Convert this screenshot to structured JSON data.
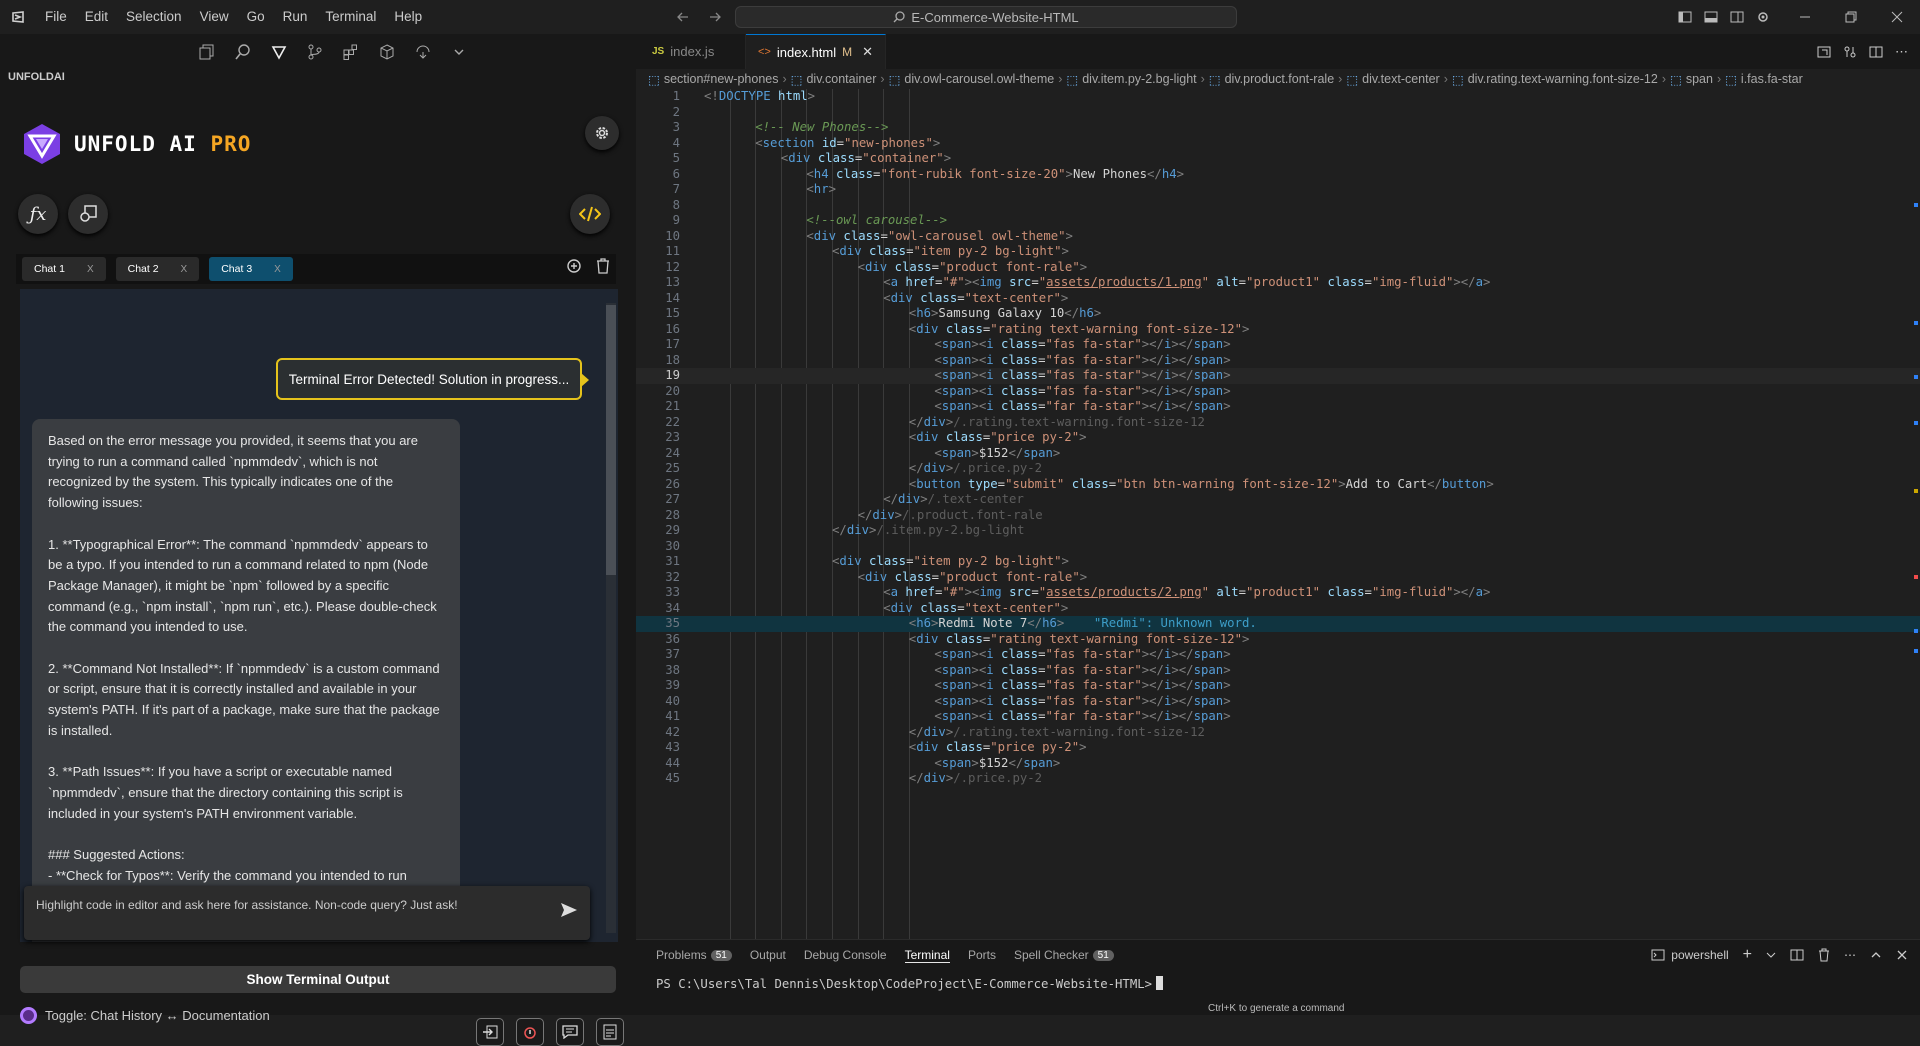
{
  "menubar": {
    "items": [
      "File",
      "Edit",
      "Selection",
      "View",
      "Go",
      "Run",
      "Terminal",
      "Help"
    ]
  },
  "search": {
    "text": "E-Commerce-Website-HTML"
  },
  "left_panel": {
    "heading": "UNFOLDAI",
    "brand": {
      "name": "UNFOLD AI",
      "pro": "PRO"
    },
    "chat_tabs": [
      {
        "label": "Chat 1",
        "close": "X"
      },
      {
        "label": "Chat 2",
        "close": "X"
      },
      {
        "label": "Chat 3",
        "close": "X"
      }
    ],
    "notice": "Terminal Error Detected! Solution in progress...",
    "message": "Based on the error message you provided, it seems that you are trying to run a command called `npmmdedv`, which is not recognized by the system. This typically indicates one of the following issues:\n\n1. **Typographical Error**: The command `npmmdedv` appears to be a typo. If you intended to run a command related to npm (Node Package Manager), it might be `npm` followed by a specific command (e.g., `npm install`, `npm run`, etc.). Please double-check the command you intended to use.\n\n2. **Command Not Installed**: If `npmmdedv` is a custom command or script, ensure that it is correctly installed and available in your system's PATH. If it's part of a package, make sure that the package is installed.\n\n3. **Path Issues**: If you have a script or executable named `npmmdedv`, ensure that the directory containing this script is included in your system's PATH environment variable.\n\n### Suggested Actions:\n- **Check for Typos**: Verify the command you intended to run\nvalid npm command, such as:",
    "input_placeholder": "Highlight code in editor and ask here for assistance. Non-code query? Just ask!",
    "show_terminal_label": "Show Terminal Output",
    "toggle_label": "Toggle: Chat History ↔ Documentation"
  },
  "editor": {
    "tabs": [
      {
        "label": "index.js",
        "icon": "JS"
      },
      {
        "label": "index.html",
        "modified": "M",
        "close": "✕"
      }
    ],
    "breadcrumbs": [
      "section#new-phones",
      "div.container",
      "div.owl-carousel.owl-theme",
      "div.item.py-2.bg-light",
      "div.product.font-rale",
      "div.text-center",
      "div.rating.text-warning.font-size-12",
      "span",
      "i.fas.fa-star"
    ],
    "current_line": 19,
    "lines": [
      {
        "n": "1",
        "i": 0,
        "html": "<span class='p'>&lt;!</span><span class='t'>DOCTYPE</span> <span class='a'>html</span><span class='p'>&gt;</span>"
      },
      {
        "n": "2",
        "i": 0,
        "html": ""
      },
      {
        "n": "3",
        "i": 2,
        "html": "<span class='c'>&lt;!-- New Phones--&gt;</span>"
      },
      {
        "n": "4",
        "i": 2,
        "html": "<span class='p'>&lt;</span><span class='t'>section</span> <span class='a'>id</span><span class='x'>=</span><span class='s'>\"new-phones\"</span><span class='p'>&gt;</span>"
      },
      {
        "n": "5",
        "i": 3,
        "html": "<span class='p'>&lt;</span><span class='t'>div</span> <span class='a'>class</span><span class='x'>=</span><span class='s'>\"container\"</span><span class='p'>&gt;</span>"
      },
      {
        "n": "6",
        "i": 4,
        "html": "<span class='p'>&lt;</span><span class='t'>h4</span> <span class='a'>class</span><span class='x'>=</span><span class='s'>\"font-rubik font-size-20\"</span><span class='p'>&gt;</span><span class='x'>New Phones</span><span class='p'>&lt;/</span><span class='t'>h4</span><span class='p'>&gt;</span>"
      },
      {
        "n": "7",
        "i": 4,
        "html": "<span class='p'>&lt;</span><span class='t'>hr</span><span class='p'>&gt;</span>"
      },
      {
        "n": "8",
        "i": 0,
        "html": ""
      },
      {
        "n": "9",
        "i": 4,
        "html": "<span class='c'>&lt;!--owl carousel--&gt;</span>"
      },
      {
        "n": "10",
        "i": 4,
        "html": "<span class='p'>&lt;</span><span class='t'>div</span> <span class='a'>class</span><span class='x'>=</span><span class='s'>\"owl-carousel owl-theme\"</span><span class='p'>&gt;</span>"
      },
      {
        "n": "11",
        "i": 5,
        "html": "<span class='p'>&lt;</span><span class='t'>div</span> <span class='a'>class</span><span class='x'>=</span><span class='s'>\"item py-2 bg-light\"</span><span class='p'>&gt;</span>"
      },
      {
        "n": "12",
        "i": 6,
        "html": "<span class='p'>&lt;</span><span class='t'>div</span> <span class='a'>class</span><span class='x'>=</span><span class='s'>\"product font-rale\"</span><span class='p'>&gt;</span>"
      },
      {
        "n": "13",
        "i": 7,
        "html": "<span class='p'>&lt;</span><span class='t'>a</span> <span class='a'>href</span><span class='x'>=</span><span class='s'>\"#\"</span><span class='p'>&gt;&lt;</span><span class='t'>img</span> <span class='a'>src</span><span class='x'>=</span><span class='s'>\"<u>assets/products/1.png</u>\"</span> <span class='a'>alt</span><span class='x'>=</span><span class='s'>\"product1\"</span> <span class='a'>class</span><span class='x'>=</span><span class='s'>\"img-fluid\"</span><span class='p'>&gt;&lt;/</span><span class='t'>a</span><span class='p'>&gt;</span>"
      },
      {
        "n": "14",
        "i": 7,
        "html": "<span class='p'>&lt;</span><span class='t'>div</span> <span class='a'>class</span><span class='x'>=</span><span class='s'>\"text-center\"</span><span class='p'>&gt;</span>"
      },
      {
        "n": "15",
        "i": 8,
        "html": "<span class='p'>&lt;</span><span class='t'>h6</span><span class='p'>&gt;</span><span class='x'>Samsung Galaxy 10</span><span class='p'>&lt;/</span><span class='t'>h6</span><span class='p'>&gt;</span>"
      },
      {
        "n": "16",
        "i": 8,
        "html": "<span class='p'>&lt;</span><span class='t'>div</span> <span class='a'>class</span><span class='x'>=</span><span class='s'>\"rating text-warning font-size-12\"</span><span class='p'>&gt;</span>"
      },
      {
        "n": "17",
        "i": 9,
        "html": "<span class='p'>&lt;</span><span class='t'>span</span><span class='p'>&gt;&lt;</span><span class='t'>i</span> <span class='a'>class</span><span class='x'>=</span><span class='s'>\"fas fa-star\"</span><span class='p'>&gt;&lt;/</span><span class='t'>i</span><span class='p'>&gt;&lt;/</span><span class='t'>span</span><span class='p'>&gt;</span>"
      },
      {
        "n": "18",
        "i": 9,
        "html": "<span class='p'>&lt;</span><span class='t'>span</span><span class='p'>&gt;&lt;</span><span class='t'>i</span> <span class='a'>class</span><span class='x'>=</span><span class='s'>\"fas fa-star\"</span><span class='p'>&gt;&lt;/</span><span class='t'>i</span><span class='p'>&gt;&lt;/</span><span class='t'>span</span><span class='p'>&gt;</span>"
      },
      {
        "n": "19",
        "i": 9,
        "html": "<span class='p'>&lt;</span><span class='t'>span</span><span class='p'>&gt;&lt;</span><span class='t'>i</span> <span class='a'>class</span><span class='x'>=</span><span class='s'>\"fas fa-star\"</span><span class='p'>&gt;&lt;/</span><span class='t'>i</span><span class='p'>&gt;&lt;/</span><span class='t'>span</span><span class='p'>&gt;</span>"
      },
      {
        "n": "20",
        "i": 9,
        "html": "<span class='p'>&lt;</span><span class='t'>span</span><span class='p'>&gt;&lt;</span><span class='t'>i</span> <span class='a'>class</span><span class='x'>=</span><span class='s'>\"fas fa-star\"</span><span class='p'>&gt;&lt;/</span><span class='t'>i</span><span class='p'>&gt;&lt;/</span><span class='t'>span</span><span class='p'>&gt;</span>"
      },
      {
        "n": "21",
        "i": 9,
        "html": "<span class='p'>&lt;</span><span class='t'>span</span><span class='p'>&gt;&lt;</span><span class='t'>i</span> <span class='a'>class</span><span class='x'>=</span><span class='s'>\"far fa-star\"</span><span class='p'>&gt;&lt;/</span><span class='t'>i</span><span class='p'>&gt;&lt;/</span><span class='t'>span</span><span class='p'>&gt;</span>"
      },
      {
        "n": "22",
        "i": 8,
        "html": "<span class='p'>&lt;/</span><span class='t'>div</span><span class='p'>&gt;</span><span class='cm'>/.rating.text-warning.font-size-12</span>"
      },
      {
        "n": "23",
        "i": 8,
        "html": "<span class='p'>&lt;</span><span class='t'>div</span> <span class='a'>class</span><span class='x'>=</span><span class='s'>\"price py-2\"</span><span class='p'>&gt;</span>"
      },
      {
        "n": "24",
        "i": 9,
        "html": "<span class='p'>&lt;</span><span class='t'>span</span><span class='p'>&gt;</span><span class='x'>$152</span><span class='p'>&lt;/</span><span class='t'>span</span><span class='p'>&gt;</span>"
      },
      {
        "n": "25",
        "i": 8,
        "html": "<span class='p'>&lt;/</span><span class='t'>div</span><span class='p'>&gt;</span><span class='cm'>/.price.py-2</span>"
      },
      {
        "n": "26",
        "i": 8,
        "html": "<span class='p'>&lt;</span><span class='t'>button</span> <span class='a'>type</span><span class='x'>=</span><span class='s'>\"submit\"</span> <span class='a'>class</span><span class='x'>=</span><span class='s'>\"btn btn-warning font-size-12\"</span><span class='p'>&gt;</span><span class='x'>Add to Cart</span><span class='p'>&lt;/</span><span class='t'>button</span><span class='p'>&gt;</span>"
      },
      {
        "n": "27",
        "i": 7,
        "html": "<span class='p'>&lt;/</span><span class='t'>div</span><span class='p'>&gt;</span><span class='cm'>/.text-center</span>"
      },
      {
        "n": "28",
        "i": 6,
        "html": "<span class='p'>&lt;/</span><span class='t'>div</span><span class='p'>&gt;</span><span class='cm'>/.product.font-rale</span>"
      },
      {
        "n": "29",
        "i": 5,
        "html": "<span class='p'>&lt;/</span><span class='t'>div</span><span class='p'>&gt;</span><span class='cm'>/.item.py-2.bg-light</span>"
      },
      {
        "n": "30",
        "i": 0,
        "html": ""
      },
      {
        "n": "31",
        "i": 5,
        "html": "<span class='p'>&lt;</span><span class='t'>div</span> <span class='a'>class</span><span class='x'>=</span><span class='s'>\"item py-2 bg-light\"</span><span class='p'>&gt;</span>"
      },
      {
        "n": "32",
        "i": 6,
        "html": "<span class='p'>&lt;</span><span class='t'>div</span> <span class='a'>class</span><span class='x'>=</span><span class='s'>\"product font-rale\"</span><span class='p'>&gt;</span>"
      },
      {
        "n": "33",
        "i": 7,
        "html": "<span class='p'>&lt;</span><span class='t'>a</span> <span class='a'>href</span><span class='x'>=</span><span class='s'>\"#\"</span><span class='p'>&gt;&lt;</span><span class='t'>img</span> <span class='a'>src</span><span class='x'>=</span><span class='s'>\"<u>assets/products/2.png</u>\"</span> <span class='a'>alt</span><span class='x'>=</span><span class='s'>\"product1\"</span> <span class='a'>class</span><span class='x'>=</span><span class='s'>\"img-fluid\"</span><span class='p'>&gt;&lt;/</span><span class='t'>a</span><span class='p'>&gt;</span>"
      },
      {
        "n": "34",
        "i": 7,
        "html": "<span class='p'>&lt;</span><span class='t'>div</span> <span class='a'>class</span><span class='x'>=</span><span class='s'>\"text-center\"</span><span class='p'>&gt;</span>"
      },
      {
        "n": "35",
        "i": 8,
        "html": "<span class='p'>&lt;</span><span class='t'>h6</span><span class='p'>&gt;</span><span class='x'>Redmi Note 7</span><span class='p'>&lt;/</span><span class='t'>h6</span><span class='p'>&gt;</span>    <span class='warn'>\"Redmi\": Unknown word.</span>"
      },
      {
        "n": "36",
        "i": 8,
        "html": "<span class='p'>&lt;</span><span class='t'>div</span> <span class='a'>class</span><span class='x'>=</span><span class='s'>\"rating text-warning font-size-12\"</span><span class='p'>&gt;</span>"
      },
      {
        "n": "37",
        "i": 9,
        "html": "<span class='p'>&lt;</span><span class='t'>span</span><span class='p'>&gt;&lt;</span><span class='t'>i</span> <span class='a'>class</span><span class='x'>=</span><span class='s'>\"fas fa-star\"</span><span class='p'>&gt;&lt;/</span><span class='t'>i</span><span class='p'>&gt;&lt;/</span><span class='t'>span</span><span class='p'>&gt;</span>"
      },
      {
        "n": "38",
        "i": 9,
        "html": "<span class='p'>&lt;</span><span class='t'>span</span><span class='p'>&gt;&lt;</span><span class='t'>i</span> <span class='a'>class</span><span class='x'>=</span><span class='s'>\"fas fa-star\"</span><span class='p'>&gt;&lt;/</span><span class='t'>i</span><span class='p'>&gt;&lt;/</span><span class='t'>span</span><span class='p'>&gt;</span>"
      },
      {
        "n": "39",
        "i": 9,
        "html": "<span class='p'>&lt;</span><span class='t'>span</span><span class='p'>&gt;&lt;</span><span class='t'>i</span> <span class='a'>class</span><span class='x'>=</span><span class='s'>\"fas fa-star\"</span><span class='p'>&gt;&lt;/</span><span class='t'>i</span><span class='p'>&gt;&lt;/</span><span class='t'>span</span><span class='p'>&gt;</span>"
      },
      {
        "n": "40",
        "i": 9,
        "html": "<span class='p'>&lt;</span><span class='t'>span</span><span class='p'>&gt;&lt;</span><span class='t'>i</span> <span class='a'>class</span><span class='x'>=</span><span class='s'>\"fas fa-star\"</span><span class='p'>&gt;&lt;/</span><span class='t'>i</span><span class='p'>&gt;&lt;/</span><span class='t'>span</span><span class='p'>&gt;</span>"
      },
      {
        "n": "41",
        "i": 9,
        "html": "<span class='p'>&lt;</span><span class='t'>span</span><span class='p'>&gt;&lt;</span><span class='t'>i</span> <span class='a'>class</span><span class='x'>=</span><span class='s'>\"far fa-star\"</span><span class='p'>&gt;&lt;/</span><span class='t'>i</span><span class='p'>&gt;&lt;/</span><span class='t'>span</span><span class='p'>&gt;</span>"
      },
      {
        "n": "42",
        "i": 8,
        "html": "<span class='p'>&lt;/</span><span class='t'>div</span><span class='p'>&gt;</span><span class='cm'>/.rating.text-warning.font-size-12</span>"
      },
      {
        "n": "43",
        "i": 8,
        "html": "<span class='p'>&lt;</span><span class='t'>div</span> <span class='a'>class</span><span class='x'>=</span><span class='s'>\"price py-2\"</span><span class='p'>&gt;</span>"
      },
      {
        "n": "44",
        "i": 9,
        "html": "<span class='p'>&lt;</span><span class='t'>span</span><span class='p'>&gt;</span><span class='x'>$152</span><span class='p'>&lt;/</span><span class='t'>span</span><span class='p'>&gt;</span>"
      },
      {
        "n": "45",
        "i": 8,
        "html": "<span class='p'>&lt;/</span><span class='t'>div</span><span class='p'>&gt;</span><span class='cm'>/.price.py-2</span>"
      }
    ]
  },
  "panel": {
    "tabs": [
      {
        "label": "Problems",
        "badge": "51"
      },
      {
        "label": "Output"
      },
      {
        "label": "Debug Console"
      },
      {
        "label": "Terminal",
        "active": true
      },
      {
        "label": "Ports"
      },
      {
        "label": "Spell Checker",
        "badge": "51"
      }
    ],
    "shell": "powershell",
    "prompt": "PS C:\\Users\\Tal Dennis\\Desktop\\CodeProject\\E-Commerce-Website-HTML>",
    "hint": "Ctrl+K to generate a command"
  }
}
